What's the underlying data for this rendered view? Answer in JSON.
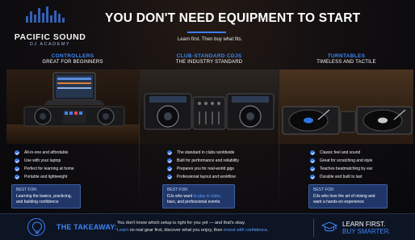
{
  "brand": {
    "name": "PACIFIC SOUND",
    "sub": "DJ ACADEMY"
  },
  "header": {
    "title": "YOU DON'T NEED EQUIPMENT TO START",
    "subtitle": "Learn first. Then buy what fits."
  },
  "columns": [
    {
      "title": "CONTROLLERS",
      "subtitle": "GREAT FOR BEGINNERS",
      "features": [
        "All-in-one and affordable",
        "Use with your laptop",
        "Perfect for learning at home",
        "Portable and lightweight"
      ],
      "best_label": "BEST FOR:",
      "best_text": "Learning the basics, practicing, and building confidence"
    },
    {
      "title": "CLUB-STANDARD CDJS",
      "subtitle": "THE INDUSTRY STANDARD",
      "features": [
        "The standard in clubs worldwide",
        "Built for performance and reliability",
        "Prepares you for real-world gigs",
        "Professional layout and workflow"
      ],
      "best_label": "BEST FOR:",
      "best_pre": "DJs who want ",
      "best_highlight": "to play in clubs,",
      "best_post": "bars, and professional events"
    },
    {
      "title": "TURNTABLES",
      "subtitle": "TIMELESS AND TACTILE",
      "features": [
        "Classic feel and sound",
        "Great for scratching and style",
        "Teaches beatmatching by ear",
        "Durable and built to last"
      ],
      "best_label": "BEST FOR:",
      "best_text": "DJs who love the art of mixing and want a hands-on experience"
    }
  ],
  "footer": {
    "takeaway": "THE TAKEAWAY:",
    "line1": "You don't know which setup is right for you yet — and that's okay.",
    "learn": "Learn",
    "mid": " on real gear first, discover what you enjoy, then ",
    "invest": "invest with confidence",
    "end": ".",
    "right1": "LEARN FIRST.",
    "right2": "BUY SMARTER."
  },
  "colors": {
    "accent": "#3d86f5",
    "panel": "#28488c",
    "background": "#0b0b10"
  },
  "icons": [
    "check-icon",
    "lightbulb-icon",
    "graduation-cap-icon"
  ]
}
